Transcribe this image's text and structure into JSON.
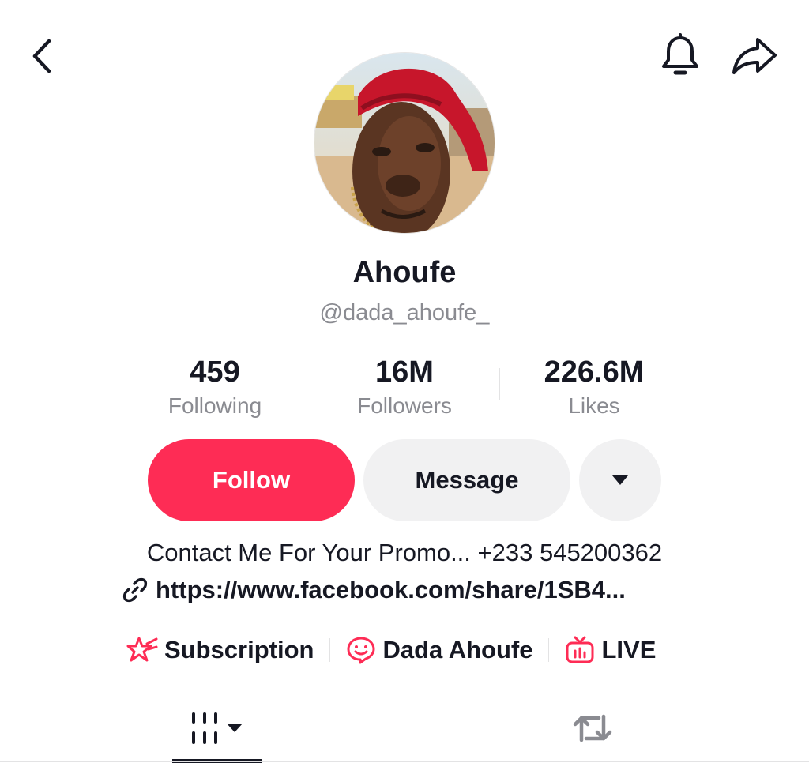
{
  "header": {
    "back_icon": "chevron-left-icon",
    "bell_icon": "bell-icon",
    "share_icon": "share-arrow-icon"
  },
  "profile": {
    "display_name": "Ahoufe",
    "username": "@dada_ahoufe_"
  },
  "stats": [
    {
      "value": "459",
      "label": "Following"
    },
    {
      "value": "16M",
      "label": "Followers"
    },
    {
      "value": "226.6M",
      "label": "Likes"
    }
  ],
  "actions": {
    "follow_label": "Follow",
    "message_label": "Message",
    "more_icon": "caret-down-icon"
  },
  "bio": {
    "text": "Contact Me For Your Promo... +233 545200362",
    "link_text": "https://www.facebook.com/share/1SB4..."
  },
  "chips": [
    {
      "label": "Subscription",
      "icon": "star-badge-icon"
    },
    {
      "label": "Dada Ahoufe",
      "icon": "chat-smile-icon"
    },
    {
      "label": "LIVE",
      "icon": "tv-icon"
    }
  ],
  "tabs": [
    {
      "icon": "videos-grid-icon"
    },
    {
      "icon": "repost-icon"
    }
  ],
  "colors": {
    "accent": "#fe2c55",
    "text": "#161823",
    "muted": "#8a8b91",
    "button_bg": "#f1f1f2"
  }
}
